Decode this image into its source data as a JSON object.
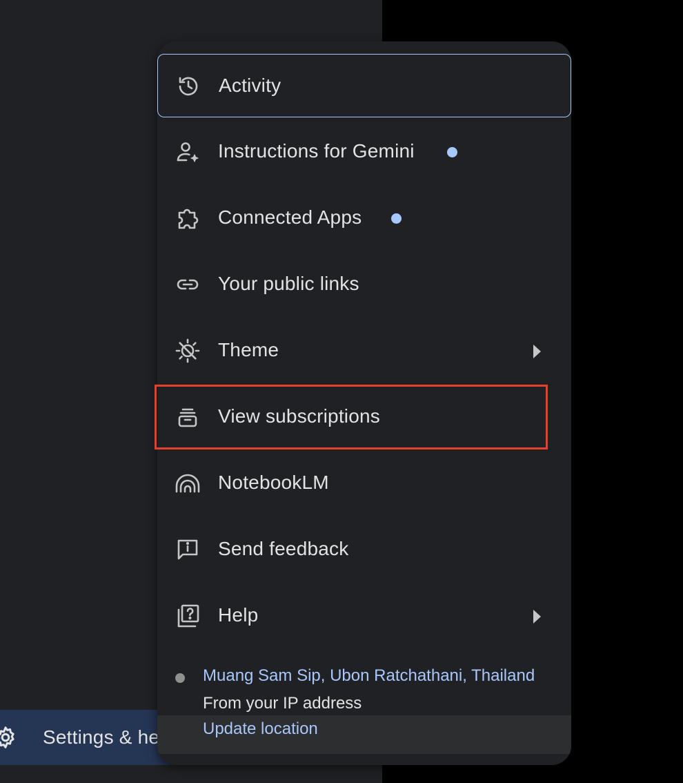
{
  "background": {
    "settings_label": "Settings & help",
    "settings_icon": "gear-icon"
  },
  "menu": {
    "items": [
      {
        "label": "Activity",
        "icon": "history-icon",
        "focused": true,
        "badge": false,
        "submenu": false
      },
      {
        "label": "Instructions for Gemini",
        "icon": "person-sparkle-icon",
        "focused": false,
        "badge": true,
        "submenu": false
      },
      {
        "label": "Connected Apps",
        "icon": "puzzle-icon",
        "focused": false,
        "badge": true,
        "submenu": false
      },
      {
        "label": "Your public links",
        "icon": "link-icon",
        "focused": false,
        "badge": false,
        "submenu": false
      },
      {
        "label": "Theme",
        "icon": "theme-icon",
        "focused": false,
        "badge": false,
        "submenu": true
      },
      {
        "label": "View subscriptions",
        "icon": "subscriptions-icon",
        "focused": false,
        "badge": false,
        "submenu": false,
        "annotated": true
      },
      {
        "label": "NotebookLM",
        "icon": "notebooklm-icon",
        "focused": false,
        "badge": false,
        "submenu": false
      },
      {
        "label": "Send feedback",
        "icon": "feedback-icon",
        "focused": false,
        "badge": false,
        "submenu": false
      },
      {
        "label": "Help",
        "icon": "help-icon",
        "focused": false,
        "badge": false,
        "submenu": true
      }
    ],
    "location": {
      "place": "Muang Sam Sip, Ubon Ratchathani, Thailand",
      "source": "From your IP address",
      "update_label": "Update location"
    }
  },
  "colors": {
    "accent": "#a8c7fa",
    "menu_bg": "#202124",
    "text": "#e3e3e3",
    "annotation": "#e5402b",
    "settings_bg": "#253554"
  }
}
